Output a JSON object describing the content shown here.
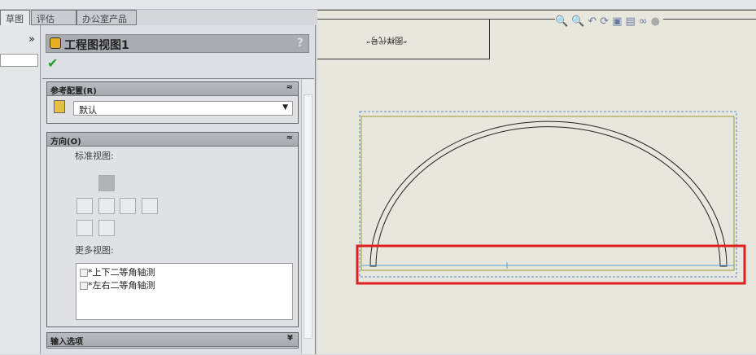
{
  "tabs": [
    {
      "label": "草图"
    },
    {
      "label": "评估"
    },
    {
      "label": "办公室产品"
    }
  ],
  "left_panel": {
    "expand_label": "»"
  },
  "property_manager": {
    "title": "工程图视图1",
    "help": "?",
    "ref_config": {
      "header": "参考配置(R)",
      "selected": "默认"
    },
    "orientation": {
      "header": "方向(O)",
      "standard_views_label": "标准视图:",
      "more_views_label": "更多视图:",
      "more_views": [
        {
          "label": "*上下二等角轴测",
          "checked": false
        },
        {
          "label": "*左右二等角轴测",
          "checked": false
        }
      ]
    },
    "import_options": {
      "header": "输入选项"
    }
  },
  "drawing": {
    "title_block_text": "“图样代号”",
    "highlight_color": "#e02020"
  }
}
